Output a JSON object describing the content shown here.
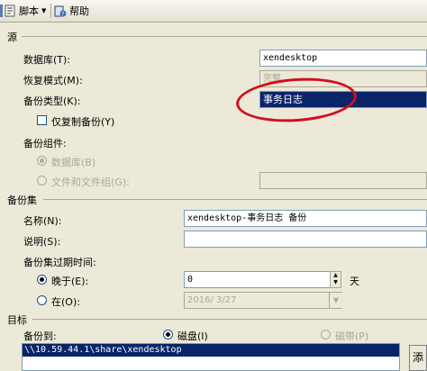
{
  "toolbar": {
    "script_label": "脚本",
    "help_label": "帮助"
  },
  "source": {
    "title": "源",
    "database_label": "数据库(T):",
    "database_value": "xendesktop",
    "recovery_label": "恢复模式(M):",
    "recovery_value": "完整",
    "backup_type_label": "备份类型(K):",
    "backup_type_value": "事务日志",
    "copy_only_label": "仅复制备份(Y)",
    "component_label": "备份组件:",
    "component_db_label": "数据库(B)",
    "component_files_label": "文件和文件组(G):"
  },
  "backup_set": {
    "title": "备份集",
    "name_label": "名称(N):",
    "name_value": "xendesktop-事务日志  备份",
    "desc_label": "说明(S):",
    "desc_value": "",
    "expire_label": "备份集过期时间:",
    "after_label": "晚于(E):",
    "after_value": "0",
    "after_unit": "天",
    "on_label": "在(O):",
    "on_value": "2016/ 3/27"
  },
  "target": {
    "title": "目标",
    "backup_to_label": "备份到:",
    "disk_label": "磁盘(I)",
    "tape_label": "磁带(P)",
    "path": "\\\\10.59.44.1\\share\\xendesktop",
    "side_button_label": "添"
  }
}
